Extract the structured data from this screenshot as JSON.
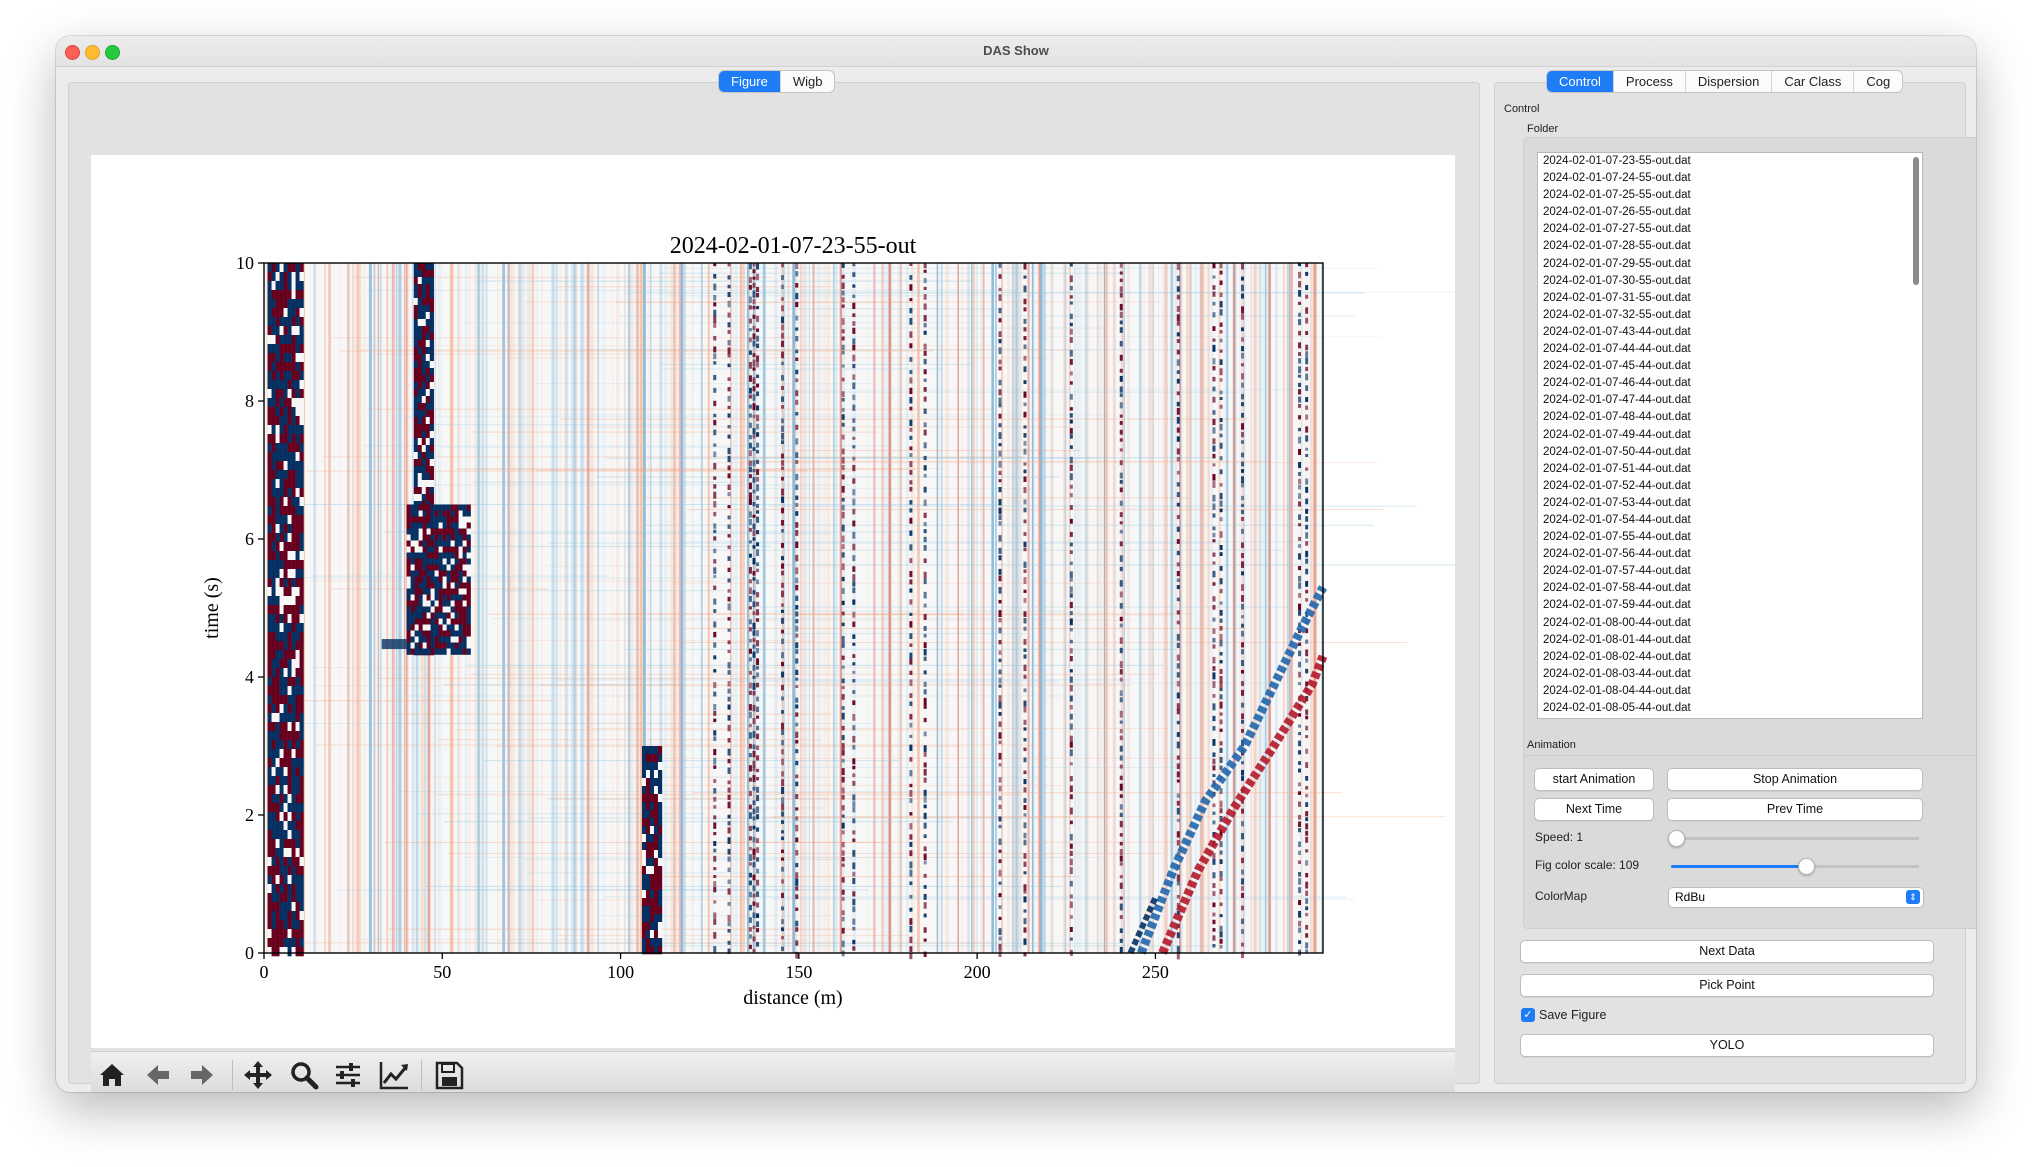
{
  "window": {
    "title": "DAS Show"
  },
  "left_tabs": [
    {
      "label": "Figure",
      "active": true
    },
    {
      "label": "Wigb",
      "active": false
    }
  ],
  "right_tabs": [
    {
      "label": "Control",
      "active": true
    },
    {
      "label": "Process",
      "active": false
    },
    {
      "label": "Dispersion",
      "active": false
    },
    {
      "label": "Car Class",
      "active": false
    },
    {
      "label": "Cog",
      "active": false
    }
  ],
  "toolbar": {
    "icons": [
      "home-icon",
      "back-arrow-icon",
      "forward-arrow-icon",
      "pan-icon",
      "zoom-icon",
      "subplots-icon",
      "axes-edit-icon",
      "save-icon"
    ]
  },
  "chart_data": {
    "type": "heatmap",
    "title": "2024-02-01-07-23-55-out",
    "xlabel": "distance (m)",
    "ylabel": "time (s)",
    "xlim": [
      0,
      297
    ],
    "ylim": [
      0,
      10
    ],
    "xticks": [
      0,
      50,
      100,
      150,
      200,
      250
    ],
    "yticks": [
      0,
      2,
      4,
      6,
      8,
      10
    ],
    "colormap": "RdBu",
    "colors": {
      "neg": "#053061",
      "mid": "#f7f7f7",
      "pos": "#67001f"
    }
  },
  "control": {
    "section_label": "Control",
    "folder_label": "Folder",
    "files": [
      "2024-02-01-07-23-55-out.dat",
      "2024-02-01-07-24-55-out.dat",
      "2024-02-01-07-25-55-out.dat",
      "2024-02-01-07-26-55-out.dat",
      "2024-02-01-07-27-55-out.dat",
      "2024-02-01-07-28-55-out.dat",
      "2024-02-01-07-29-55-out.dat",
      "2024-02-01-07-30-55-out.dat",
      "2024-02-01-07-31-55-out.dat",
      "2024-02-01-07-32-55-out.dat",
      "2024-02-01-07-43-44-out.dat",
      "2024-02-01-07-44-44-out.dat",
      "2024-02-01-07-45-44-out.dat",
      "2024-02-01-07-46-44-out.dat",
      "2024-02-01-07-47-44-out.dat",
      "2024-02-01-07-48-44-out.dat",
      "2024-02-01-07-49-44-out.dat",
      "2024-02-01-07-50-44-out.dat",
      "2024-02-01-07-51-44-out.dat",
      "2024-02-01-07-52-44-out.dat",
      "2024-02-01-07-53-44-out.dat",
      "2024-02-01-07-54-44-out.dat",
      "2024-02-01-07-55-44-out.dat",
      "2024-02-01-07-56-44-out.dat",
      "2024-02-01-07-57-44-out.dat",
      "2024-02-01-07-58-44-out.dat",
      "2024-02-01-07-59-44-out.dat",
      "2024-02-01-08-00-44-out.dat",
      "2024-02-01-08-01-44-out.dat",
      "2024-02-01-08-02-44-out.dat",
      "2024-02-01-08-03-44-out.dat",
      "2024-02-01-08-04-44-out.dat",
      "2024-02-01-08-05-44-out.dat"
    ],
    "animation_label": "Animation",
    "start_animation": "start Animation",
    "stop_animation": "Stop Animation",
    "next_time": "Next Time",
    "prev_time": "Prev Time",
    "speed_label": "Speed: 1",
    "speed_value": 0,
    "color_scale_label": "Fig color scale: 109",
    "color_scale_value": 0.54,
    "colormap_label": "ColorMap",
    "colormap_value": "RdBu",
    "next_data": "Next Data",
    "pick_point": "Pick Point",
    "save_figure_label": "Save Figure",
    "save_figure_checked": true,
    "yolo": "YOLO"
  }
}
